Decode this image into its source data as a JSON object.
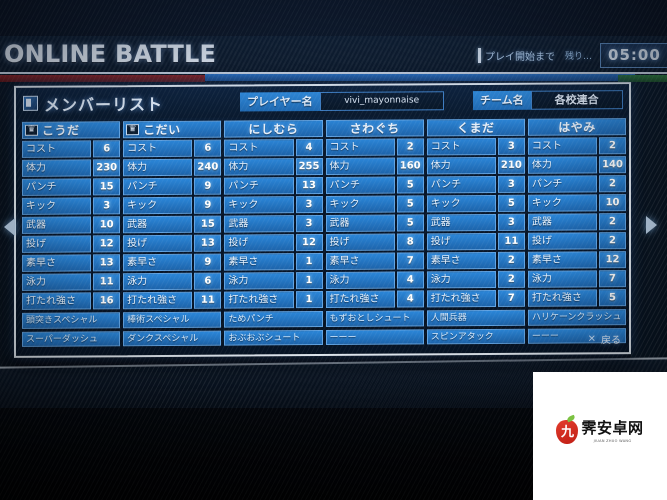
{
  "header": {
    "battle_title": "ONLINE BATTLE",
    "timer_label": "プレイ開始まで",
    "timer_remain_label": "残り…",
    "timer_value": "05:00"
  },
  "dialog": {
    "title": "メンバーリスト",
    "list_icon": "list-icon",
    "player_label": "プレイヤー名",
    "player_value": "vivi_mayonnaise",
    "team_label": "チーム名",
    "team_value": "各校連合",
    "back_x": "×",
    "back_label": "戻る",
    "arrow_left": "chevron-left-icon",
    "arrow_right": "chevron-right-icon"
  },
  "stat_labels": [
    "コスト",
    "体力",
    "パンチ",
    "キック",
    "武器",
    "投げ",
    "素早さ",
    "泳力",
    "打たれ強さ"
  ],
  "members": [
    {
      "name": "こうだ",
      "has_crown": true,
      "stats": [
        6,
        230,
        15,
        3,
        10,
        12,
        13,
        11,
        16
      ],
      "skills": [
        "頭突きスペシャル",
        "スーパーダッシュ"
      ]
    },
    {
      "name": "こだい",
      "has_crown": true,
      "stats": [
        6,
        240,
        9,
        9,
        15,
        13,
        9,
        6,
        11
      ],
      "skills": [
        "棒術スペシャル",
        "ダンクスペシャル"
      ]
    },
    {
      "name": "にしむら",
      "has_crown": false,
      "stats": [
        4,
        255,
        13,
        3,
        3,
        12,
        1,
        1,
        1
      ],
      "skills": [
        "ためパンチ",
        "おぶおぶシュート"
      ]
    },
    {
      "name": "さわぐち",
      "has_crown": false,
      "stats": [
        2,
        160,
        5,
        5,
        5,
        8,
        7,
        4,
        4
      ],
      "skills": [
        "もずおとしシュート",
        "ーーー"
      ]
    },
    {
      "name": "くまだ",
      "has_crown": false,
      "stats": [
        3,
        210,
        3,
        5,
        3,
        11,
        2,
        2,
        7
      ],
      "skills": [
        "人間兵器",
        "スピンアタック"
      ]
    },
    {
      "name": "はやみ",
      "has_crown": false,
      "stats": [
        2,
        140,
        2,
        10,
        2,
        2,
        12,
        7,
        5
      ],
      "skills": [
        "ハリケーンクラッシュ",
        "ーーー"
      ]
    }
  ],
  "watermark": {
    "glyph": "九",
    "text": "霁安卓网",
    "subtext": "JIUAN ZHUO WANG"
  },
  "colors": {
    "accent_blue": "#2b86d8",
    "panel_bg": "#07162a",
    "border_light": "#dfe7ef",
    "value_text": "#ffffff",
    "timer_text": "#e9f2fb",
    "watermark_red": "#e23c2c"
  }
}
